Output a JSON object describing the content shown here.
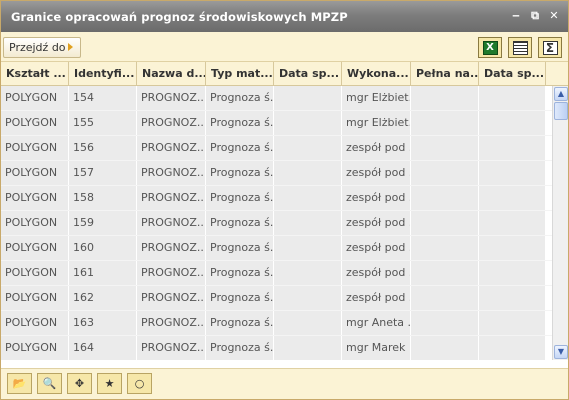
{
  "window": {
    "title": "Granice opracowań prognoz środowiskowych MPZP",
    "controls": {
      "minimize": "‒",
      "popout": "⧉",
      "close": "✕"
    }
  },
  "toolbar": {
    "goto_label": "Przejdź do",
    "icons": [
      "excel-export-icon",
      "grid-view-icon",
      "sum-icon"
    ]
  },
  "table": {
    "columns": [
      "Kształt ...",
      "Identyfi...",
      "Nazwa d...",
      "Typ mat...",
      "Data sp...",
      "Wykona...",
      "Pełna na...",
      "Data sp..."
    ],
    "rows": [
      [
        "POLYGON",
        "154",
        "PROGNOZ...",
        "Prognoza ś...",
        "",
        "mgr Elżbiet...",
        "",
        ""
      ],
      [
        "POLYGON",
        "155",
        "PROGNOZ...",
        "Prognoza ś...",
        "",
        "mgr Elżbiet...",
        "",
        ""
      ],
      [
        "POLYGON",
        "156",
        "PROGNOZ...",
        "Prognoza ś...",
        "",
        "zespół pod ...",
        "",
        ""
      ],
      [
        "POLYGON",
        "157",
        "PROGNOZ...",
        "Prognoza ś...",
        "",
        "zespół pod ...",
        "",
        ""
      ],
      [
        "POLYGON",
        "158",
        "PROGNOZ...",
        "Prognoza ś...",
        "",
        "zespół pod ...",
        "",
        ""
      ],
      [
        "POLYGON",
        "159",
        "PROGNOZ...",
        "Prognoza ś...",
        "",
        "zespół pod ...",
        "",
        ""
      ],
      [
        "POLYGON",
        "160",
        "PROGNOZ...",
        "Prognoza ś...",
        "",
        "zespół pod ...",
        "",
        ""
      ],
      [
        "POLYGON",
        "161",
        "PROGNOZ...",
        "Prognoza ś...",
        "",
        "zespół pod ...",
        "",
        ""
      ],
      [
        "POLYGON",
        "162",
        "PROGNOZ...",
        "Prognoza ś...",
        "",
        "zespół pod ...",
        "",
        ""
      ],
      [
        "POLYGON",
        "163",
        "PROGNOZ...",
        "Prognoza ś...",
        "",
        "mgr Aneta ...",
        "",
        ""
      ],
      [
        "POLYGON",
        "164",
        "PROGNOZ...",
        "Prognoza ś...",
        "",
        "mgr Marek ...",
        "",
        ""
      ]
    ]
  },
  "bottom_toolbar": {
    "icons": [
      "open-folder-icon",
      "zoom-icon",
      "pan-icon",
      "star-icon",
      "circle-icon"
    ]
  },
  "colors": {
    "titlebar": "#7d7d7d",
    "toolbar_bg": "#fbf3d5",
    "row_bg": "#ebebeb",
    "accent": "#e0a020"
  }
}
